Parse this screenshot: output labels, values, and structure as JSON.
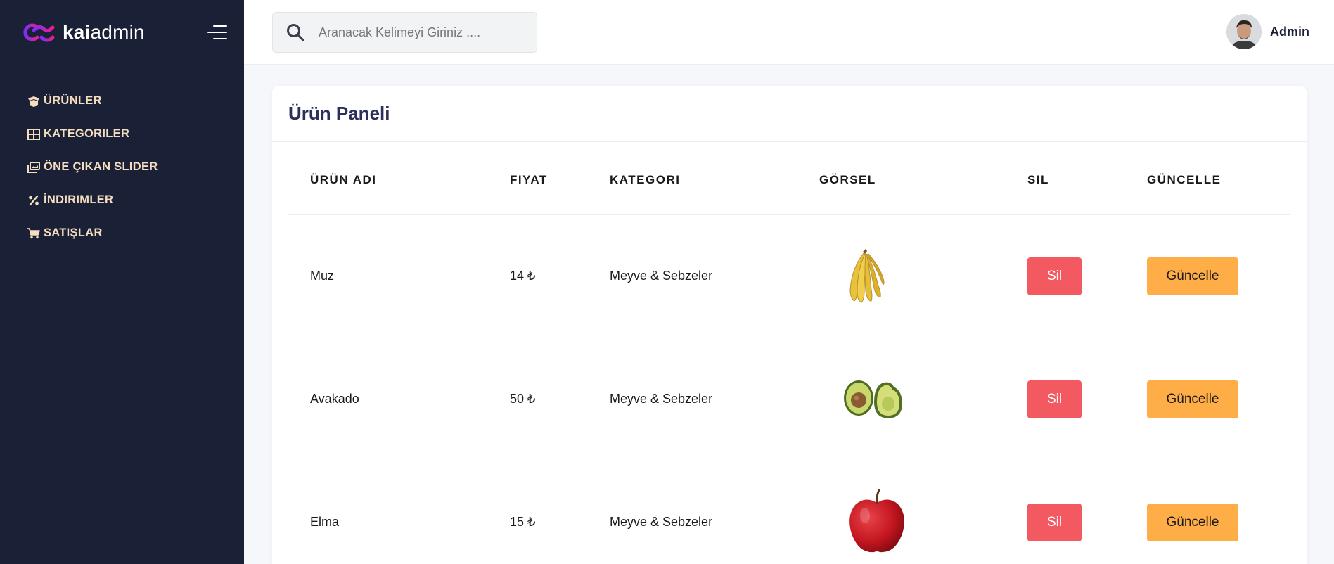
{
  "brand": {
    "name_bold": "kai",
    "name_rest": "admin",
    "accent_start": "#8a2be2",
    "accent_end": "#e91e8c"
  },
  "sidebar": {
    "items": [
      {
        "label": "ÜRÜNLER",
        "icon": "box-open-icon"
      },
      {
        "label": "KATEGORILER",
        "icon": "grid-icon"
      },
      {
        "label": "ÖNE ÇIKAN SLIDER",
        "icon": "images-icon"
      },
      {
        "label": "İNDIRIMLER",
        "icon": "percent-icon"
      },
      {
        "label": "SATIŞLAR",
        "icon": "shopping-cart-icon"
      }
    ]
  },
  "header": {
    "search_placeholder": "Aranacak Kelimeyi Giriniz ....",
    "user_name": "Admin"
  },
  "panel": {
    "title": "Ürün Paneli",
    "columns": [
      "ÜRÜN ADI",
      "FIYAT",
      "KATEGORI",
      "GÖRSEL",
      "SIL",
      "GÜNCELLE"
    ],
    "rows": [
      {
        "name": "Muz",
        "price": "14 ₺",
        "category": "Meyve & Sebzeler",
        "image": "banana",
        "delete_label": "Sil",
        "update_label": "Güncelle"
      },
      {
        "name": "Avakado",
        "price": "50 ₺",
        "category": "Meyve & Sebzeler",
        "image": "avocado",
        "delete_label": "Sil",
        "update_label": "Güncelle"
      },
      {
        "name": "Elma",
        "price": "15 ₺",
        "category": "Meyve & Sebzeler",
        "image": "apple",
        "delete_label": "Sil",
        "update_label": "Güncelle"
      }
    ]
  },
  "colors": {
    "sidebar_bg": "#1a2035",
    "nav_text": "#f5dec0",
    "delete": "#f25961",
    "update": "#ffad46"
  }
}
